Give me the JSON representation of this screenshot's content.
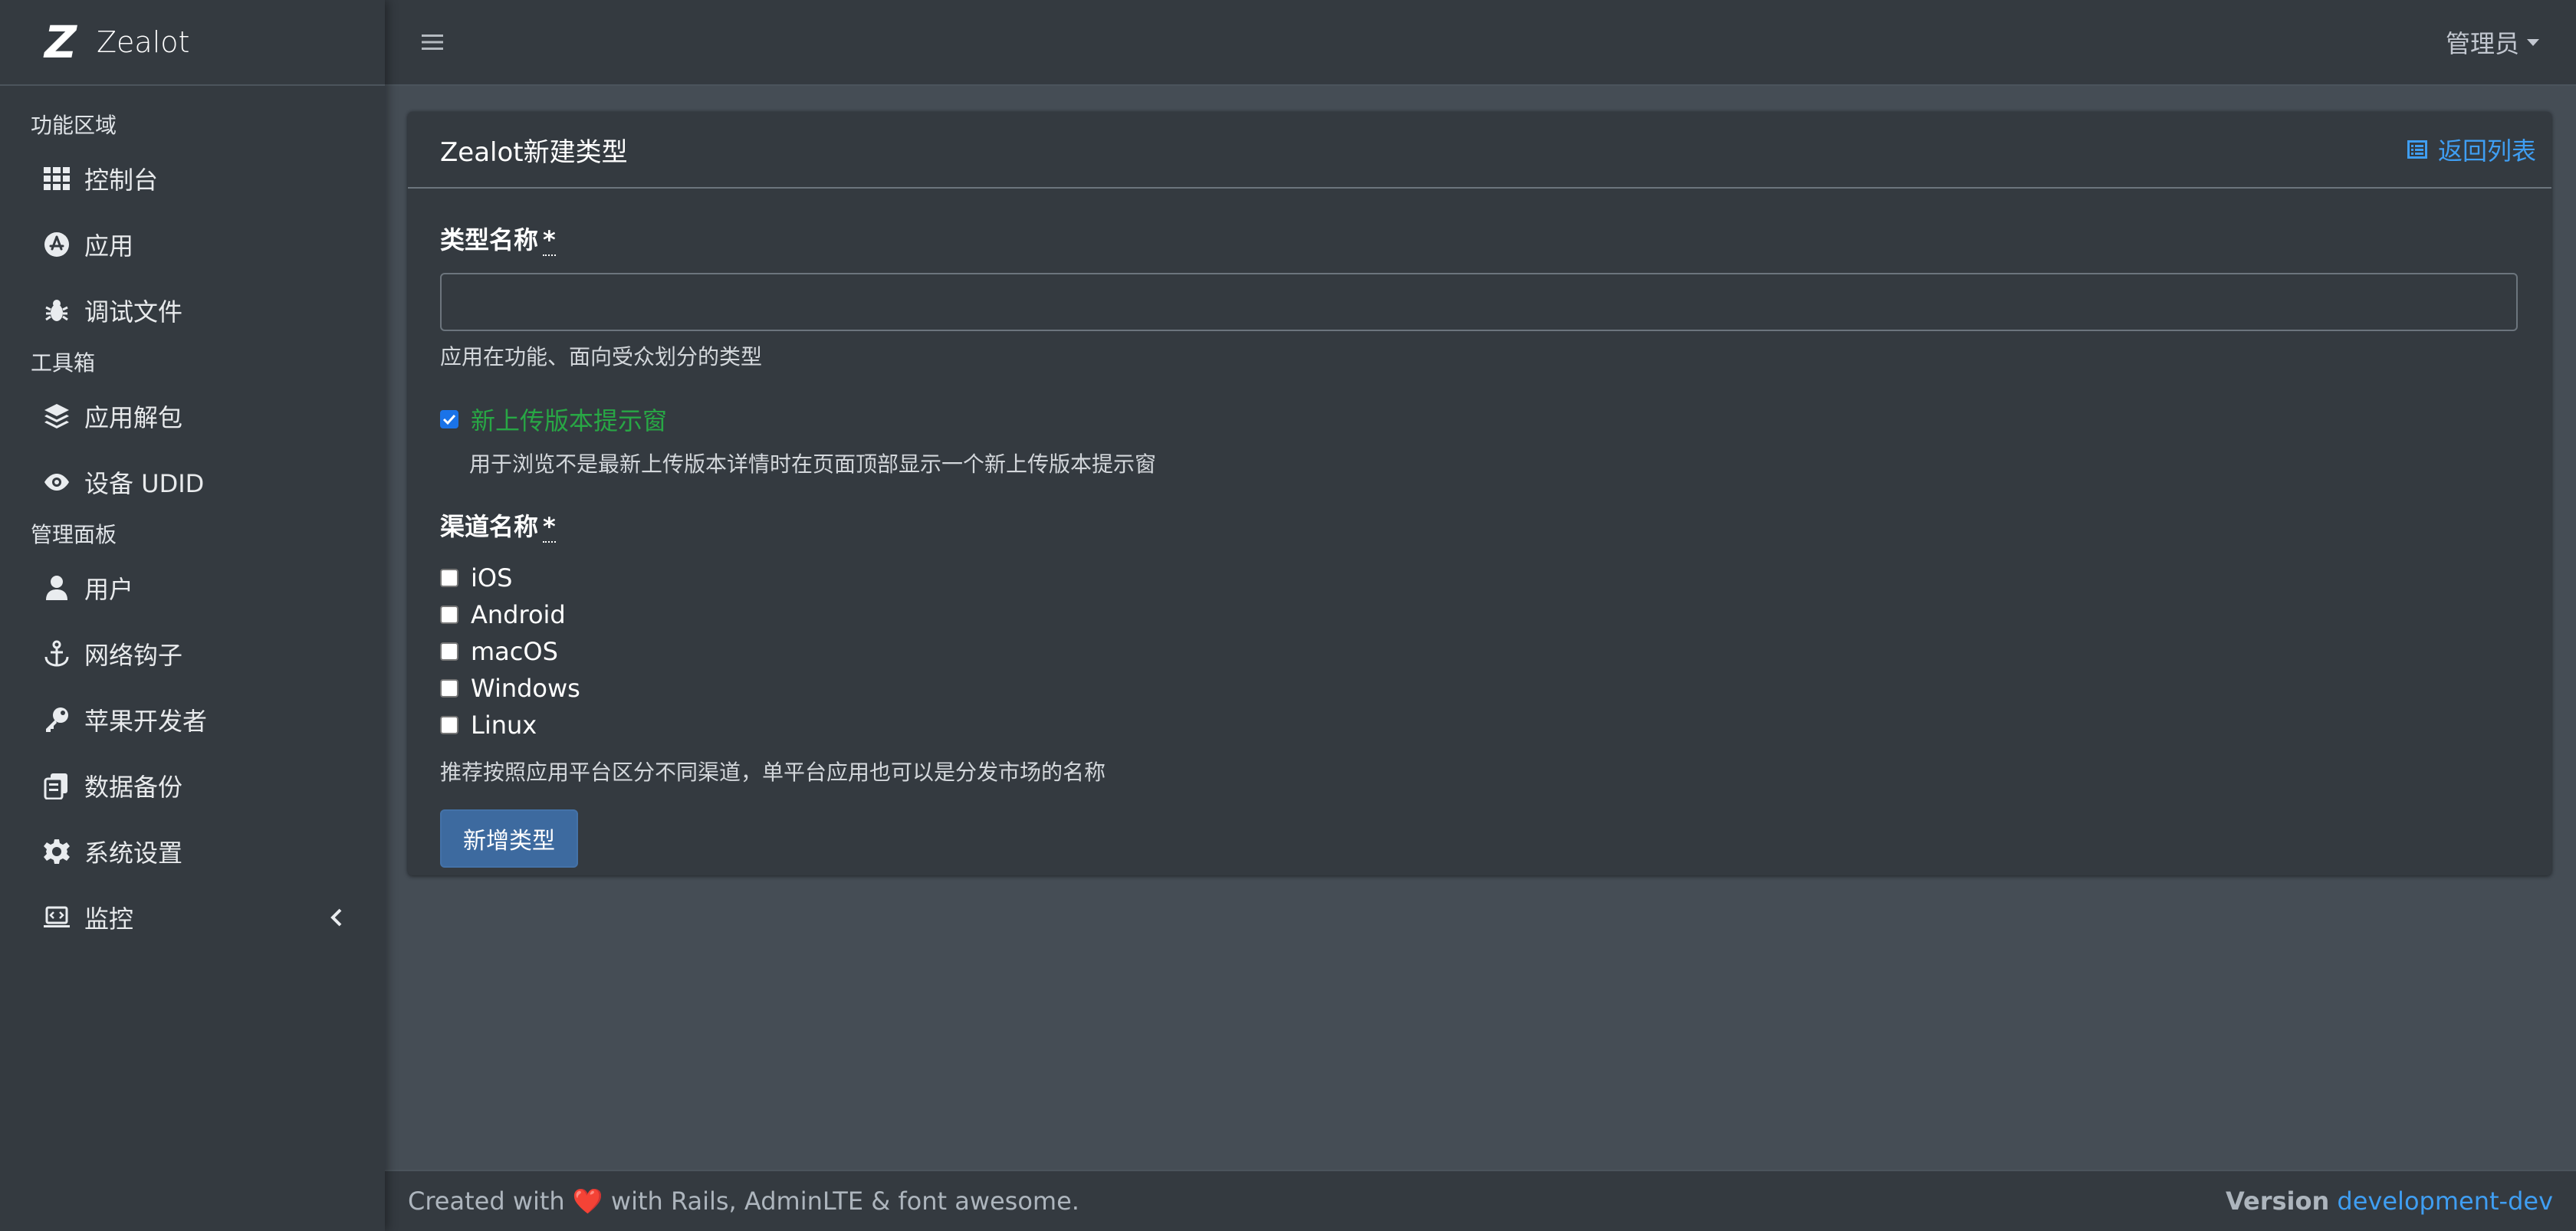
{
  "brand": {
    "logo": "Z",
    "name": "Zealot"
  },
  "sidebar": {
    "sections": [
      {
        "header": "功能区域",
        "items": [
          {
            "label": "控制台",
            "icon": "th-icon"
          },
          {
            "label": "应用",
            "icon": "app-store-icon"
          },
          {
            "label": "调试文件",
            "icon": "bug-icon"
          }
        ]
      },
      {
        "header": "工具箱",
        "items": [
          {
            "label": "应用解包",
            "icon": "layer-group-icon"
          },
          {
            "label": "设备 UDID",
            "icon": "eye-icon"
          }
        ]
      },
      {
        "header": "管理面板",
        "items": [
          {
            "label": "用户",
            "icon": "user-icon"
          },
          {
            "label": "网络钩子",
            "icon": "anchor-icon"
          },
          {
            "label": "苹果开发者",
            "icon": "key-icon"
          },
          {
            "label": "数据备份",
            "icon": "copy-icon"
          },
          {
            "label": "系统设置",
            "icon": "gear-icon"
          },
          {
            "label": "监控",
            "icon": "laptop-code-icon",
            "has_arrow": true
          }
        ]
      }
    ]
  },
  "topbar": {
    "user_label": "管理员"
  },
  "card": {
    "title": "Zealot新建类型",
    "back_link": "返回列表",
    "name_field": {
      "label": "类型名称",
      "required_mark": "*",
      "value": "",
      "help": "应用在功能、面向受众划分的类型"
    },
    "notice": {
      "label": "新上传版本提示窗",
      "checked": true,
      "help": "用于浏览不是最新上传版本详情时在页面顶部显示一个新上传版本提示窗"
    },
    "channels": {
      "label": "渠道名称",
      "required_mark": "*",
      "options": [
        "iOS",
        "Android",
        "macOS",
        "Windows",
        "Linux"
      ],
      "help": "推荐按照应用平台区分不同渠道，单平台应用也可以是分发市场的名称"
    },
    "submit_label": "新增类型"
  },
  "footer": {
    "created_prefix": "Created with",
    "heart": "❤️",
    "created_suffix": "with Rails, AdminLTE & font awesome.",
    "version_label": "Version",
    "version_value": "development-dev"
  },
  "colors": {
    "sidebar_bg": "#343a40",
    "content_bg": "#454d55",
    "link": "#3f9ef2",
    "success": "#28a745",
    "primary_button": "#3d6a9f"
  }
}
